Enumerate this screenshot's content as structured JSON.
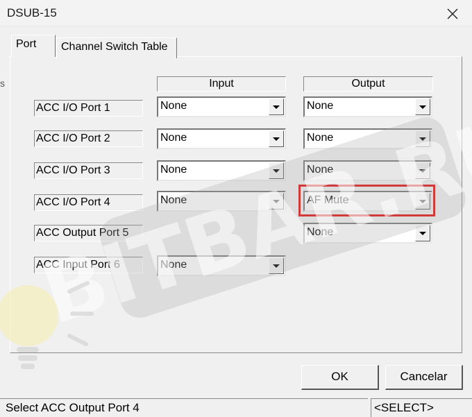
{
  "window": {
    "title": "DSUB-15"
  },
  "tabs": [
    {
      "label": "Port",
      "active": true
    },
    {
      "label": "Channel Switch Table",
      "active": false
    }
  ],
  "columns": {
    "input": "Input",
    "output": "Output"
  },
  "rows": [
    {
      "label": "ACC I/O Port 1",
      "input": "None",
      "output": "None"
    },
    {
      "label": "ACC I/O Port 2",
      "input": "None",
      "output": "None"
    },
    {
      "label": "ACC I/O Port 3",
      "input": "None",
      "output": "None"
    },
    {
      "label": "ACC I/O Port 4",
      "input": "None",
      "output": "AF Mute"
    },
    {
      "label": "ACC Output Port 5",
      "output": "None"
    },
    {
      "label": "ACC Input Port 6",
      "input": "None"
    }
  ],
  "buttons": {
    "ok": "OK",
    "cancel": "Cancelar"
  },
  "status": {
    "message": "Select ACC Output Port 4",
    "mode": "<SELECT>"
  },
  "highlight_color": "#e01010",
  "watermark_text": "BITBAR.RU",
  "edge_fragment": "s"
}
